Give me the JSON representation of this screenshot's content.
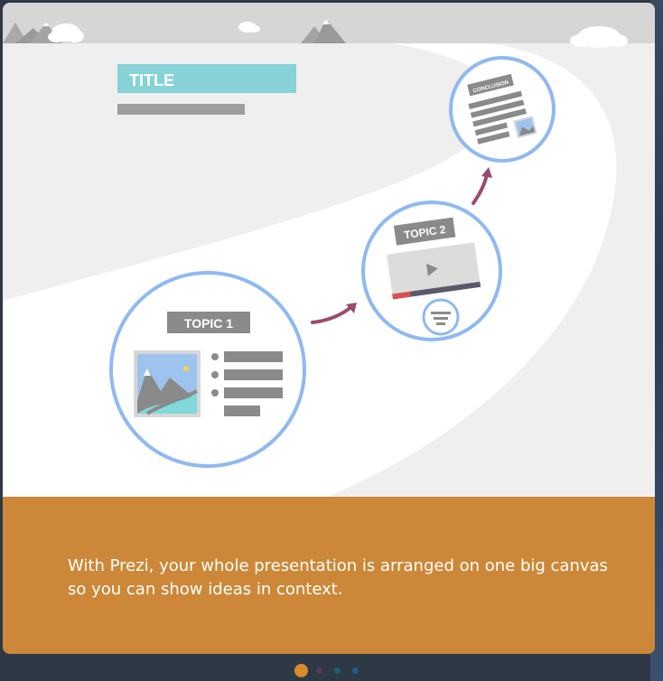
{
  "slide": {
    "title_label": "TITLE",
    "topic1_label": "TOPIC 1",
    "topic2_label": "TOPIC 2",
    "conclusion_label": "CONCLUSION"
  },
  "caption": {
    "text": "With Prezi, your whole presentation is arranged on one big canvas so you can show ideas in context."
  },
  "pagination": {
    "active_index": 0,
    "dots": [
      {
        "color": "#d98a2e"
      },
      {
        "color": "#5a3a56"
      },
      {
        "color": "#1d5e6e"
      },
      {
        "color": "#1f5a8a"
      }
    ]
  },
  "colors": {
    "accent": "#cc8838",
    "title_bar": "#86d2d6",
    "circle_stroke": "#8fb9f0",
    "arrow": "#9b4a6e"
  }
}
